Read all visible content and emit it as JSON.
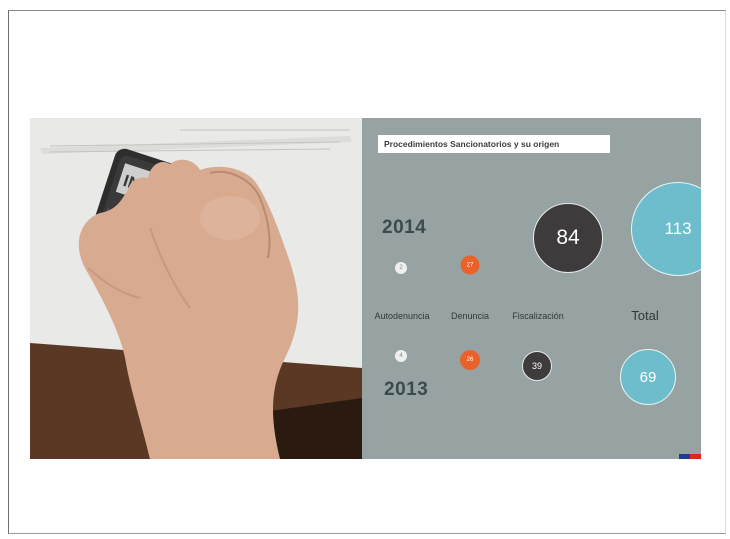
{
  "panel": {
    "title": "Procedimientos Sancionatorios y su origen"
  },
  "stamp": {
    "text": "INSTRUC"
  },
  "years": {
    "top": "2014",
    "bottom": "2013"
  },
  "categories": [
    "Autodenuncia",
    "Denuncia",
    "Fiscalización",
    "Total"
  ],
  "chart_data": {
    "type": "bubble",
    "title": "Procedimientos Sancionatorios y su origen",
    "categories": [
      "Autodenuncia",
      "Denuncia",
      "Fiscalización",
      "Total"
    ],
    "series": [
      {
        "name": "2014",
        "values": [
          2,
          27,
          84,
          113
        ]
      },
      {
        "name": "2013",
        "values": [
          4,
          26,
          39,
          69
        ]
      }
    ]
  },
  "colors": {
    "autodenuncia": "#eef0ef",
    "denuncia": "#e9622b",
    "fiscalizacion": "#3d3b3c",
    "total": "#6ebdcc",
    "panel_bg": "#97a3a2",
    "flag_blue": "#1d3f8f",
    "flag_red": "#d52b1e"
  }
}
